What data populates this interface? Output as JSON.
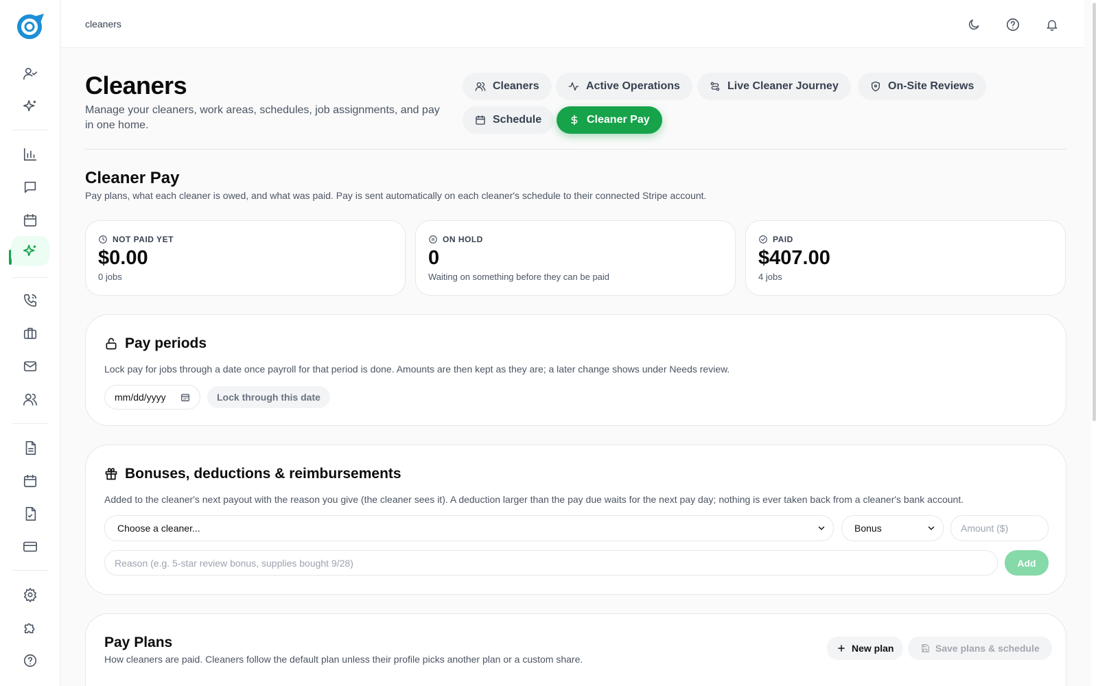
{
  "breadcrumb": "cleaners",
  "page": {
    "title": "Cleaners",
    "subtitle": "Manage your cleaners, work areas, schedules, job assignments, and pay in one home."
  },
  "tabs": [
    {
      "label": "Cleaners",
      "icon": "users-icon",
      "active": false
    },
    {
      "label": "Active Operations",
      "icon": "activity-icon",
      "active": false
    },
    {
      "label": "Live Cleaner Journey",
      "icon": "route-icon",
      "active": false
    },
    {
      "label": "On-Site Reviews",
      "icon": "shield-icon",
      "active": false
    },
    {
      "label": "Schedule",
      "icon": "calendar-icon",
      "active": false
    },
    {
      "label": "Cleaner Pay",
      "icon": "dollar-icon",
      "active": true
    }
  ],
  "section": {
    "title": "Cleaner Pay",
    "subtitle": "Pay plans, what each cleaner is owed, and what was paid. Pay is sent automatically on each cleaner's schedule to their connected Stripe account."
  },
  "stats": [
    {
      "label": "NOT PAID YET",
      "value": "$0.00",
      "note": "0 jobs",
      "icon": "clock-icon"
    },
    {
      "label": "ON HOLD",
      "value": "0",
      "note": "Waiting on something before they can be paid",
      "icon": "pause-circle-icon"
    },
    {
      "label": "PAID",
      "value": "$407.00",
      "note": "4 jobs",
      "icon": "check-circle-icon"
    }
  ],
  "pay_periods": {
    "title": "Pay periods",
    "description": "Lock pay for jobs through a date once payroll for that period is done. Amounts are then kept as they are; a later change shows under Needs review.",
    "date_placeholder": "mm/dd/yyyy",
    "lock_button": "Lock through this date"
  },
  "adjustments": {
    "title": "Bonuses, deductions & reimbursements",
    "description": "Added to the cleaner's next payout with the reason you give (the cleaner sees it). A deduction larger than the pay due waits for the next pay day; nothing is ever taken back from a cleaner's bank account.",
    "cleaner_select": "Choose a cleaner...",
    "type_select": "Bonus",
    "amount_placeholder": "Amount ($)",
    "reason_placeholder": "Reason (e.g. 5-star review bonus, supplies bought 9/28)",
    "add_button": "Add"
  },
  "pay_plans": {
    "title": "Pay Plans",
    "description": "How cleaners are paid. Cleaners follow the default plan unless their profile picks another plan or a custom share.",
    "new_plan_button": "New plan",
    "save_button": "Save plans & schedule"
  },
  "colors": {
    "accent": "#16a34a",
    "accent_soft": "#ecfdf3",
    "add_button": "#86d9a8"
  },
  "sidebar": {
    "items": [
      {
        "icon": "user-check-icon",
        "active": false
      },
      {
        "icon": "sparkles-icon",
        "active": false
      },
      {
        "icon": "bar-chart-icon",
        "active": false
      },
      {
        "icon": "message-square-icon",
        "active": false
      },
      {
        "icon": "calendar-icon",
        "active": false
      },
      {
        "icon": "sparkles-icon",
        "active": true
      },
      {
        "icon": "phone-icon",
        "active": false
      },
      {
        "icon": "briefcase-icon",
        "active": false
      },
      {
        "icon": "mail-icon",
        "active": false
      },
      {
        "icon": "users-icon",
        "active": false
      },
      {
        "icon": "file-text-icon",
        "active": false
      },
      {
        "icon": "calendar-icon",
        "active": false
      },
      {
        "icon": "file-check-icon",
        "active": false
      },
      {
        "icon": "credit-card-icon",
        "active": false
      },
      {
        "icon": "settings-icon",
        "active": false
      },
      {
        "icon": "puzzle-icon",
        "active": false
      },
      {
        "icon": "help-circle-icon",
        "active": false
      }
    ]
  }
}
